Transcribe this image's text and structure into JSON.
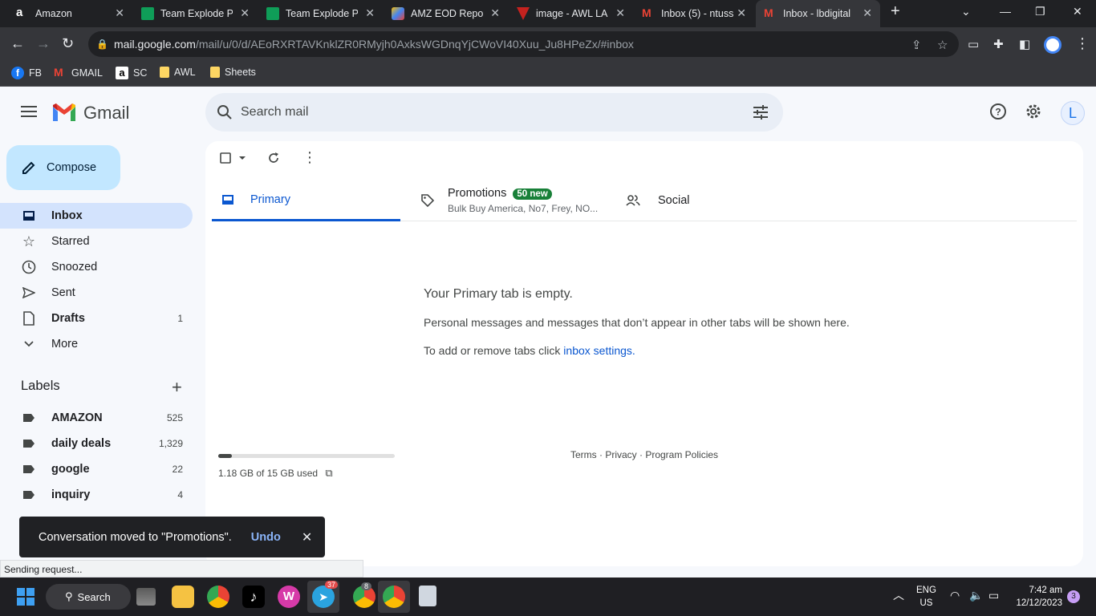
{
  "browser": {
    "tabs": [
      {
        "title": "Amazon",
        "icon": "amazon-icon"
      },
      {
        "title": "Team Explode PF",
        "icon": "sheets-icon"
      },
      {
        "title": "Team Explode Pr",
        "icon": "sheets-icon"
      },
      {
        "title": "AMZ EOD Repor",
        "icon": "brush-icon"
      },
      {
        "title": "image - AWL LA",
        "icon": "awl-icon"
      },
      {
        "title": "Inbox (5) - ntuss",
        "icon": "gmail-icon"
      },
      {
        "title": "Inbox - lbdigital",
        "icon": "gmail-icon"
      }
    ],
    "url_host": "mail.google.com",
    "url_path": "/mail/u/0/d/AEoRXRTAVKnklZR0RMyjh0AxksWGDnqYjCWoVI40Xuu_Ju8HPeZx/#inbox",
    "bookmarks": [
      "FB",
      "GMAIL",
      "SC",
      "AWL",
      "Sheets"
    ]
  },
  "gmail": {
    "logo_text": "Gmail",
    "search_placeholder": "Search mail",
    "avatar_letter": "L",
    "compose_label": "Compose",
    "nav": [
      {
        "label": "Inbox",
        "count": ""
      },
      {
        "label": "Starred",
        "count": ""
      },
      {
        "label": "Snoozed",
        "count": ""
      },
      {
        "label": "Sent",
        "count": ""
      },
      {
        "label": "Drafts",
        "count": "1"
      },
      {
        "label": "More",
        "count": ""
      }
    ],
    "labels_header": "Labels",
    "labels": [
      {
        "label": "AMAZON",
        "count": "525"
      },
      {
        "label": "daily deals",
        "count": "1,329"
      },
      {
        "label": "google",
        "count": "22"
      },
      {
        "label": "inquiry",
        "count": "4"
      }
    ],
    "tabs": {
      "primary": "Primary",
      "promotions": "Promotions",
      "promotions_badge": "50 new",
      "promotions_sub": "Bulk Buy America, No7, Frey, NO...",
      "social": "Social"
    },
    "empty_title": "Your Primary tab is empty.",
    "empty_text": "Personal messages and messages that don’t appear in other tabs will be shown here.",
    "empty_text2_prefix": "To add or remove tabs click ",
    "empty_text2_link": "inbox settings.",
    "storage_text": "1.18 GB of 15 GB used",
    "storage_fraction": 0.079,
    "footer": "Terms · Privacy · Program Policies",
    "snackbar_msg": "Conversation moved to \"Promotions\".",
    "snackbar_action": "Undo",
    "status": "Sending request..."
  },
  "taskbar": {
    "search_label": "Search",
    "telegram_badge": "37",
    "chrome_badge": "8",
    "lang": "ENG",
    "region": "US",
    "time": "7:42 am",
    "date": "12/12/2023",
    "notif_count": "3"
  }
}
